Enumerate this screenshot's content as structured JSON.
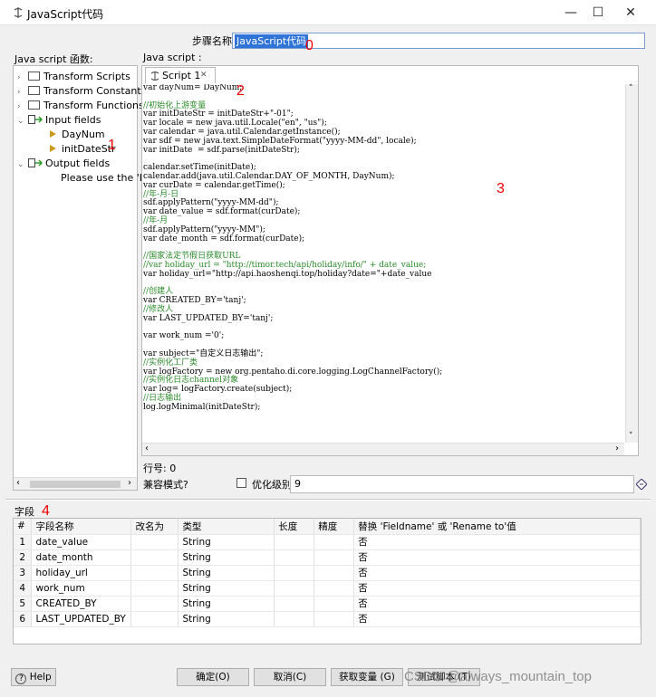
{
  "window": {
    "title": "JavaScript代码",
    "min": "—",
    "max": "☐",
    "close": "✕"
  },
  "step": {
    "label": "步骤名称",
    "value": "JavaScript代码"
  },
  "annotations": {
    "a0": "0",
    "a1": "1",
    "a2": "2",
    "a3": "3",
    "a4": "4"
  },
  "functions_panel": {
    "label": "Java script 函数:",
    "items": [
      "Transform Scripts",
      "Transform Constants",
      "Transform Functions",
      "Input fields",
      "DayNum",
      "initDateStr",
      "Output fields",
      "Please use the 'Re"
    ]
  },
  "script_panel": {
    "label": "Java script :",
    "tab": "Script 1",
    "tab_close": "✕"
  },
  "code_lines": [
    "var dayNum= DayNum;",
    "",
    "//初始化上游变量",
    "var initDateStr = initDateStr+\"-01\";",
    "var locale = new java.util.Locale(\"en\", \"us\");",
    "var calendar = java.util.Calendar.getInstance();",
    "var sdf = new java.text.SimpleDateFormat(\"yyyy-MM-dd\", locale);",
    "var initDate  = sdf.parse(initDateStr);",
    "",
    "calendar.setTime(initDate);",
    "calendar.add(java.util.Calendar.DAY_OF_MONTH, DayNum);",
    "var curDate = calendar.getTime();",
    "//年-月-日",
    "sdf.applyPattern(\"yyyy-MM-dd\");",
    "var date_value = sdf.format(curDate);",
    "//年-月",
    "sdf.applyPattern(\"yyyy-MM\");",
    "var date_month = sdf.format(curDate);",
    "",
    "//国家法定节假日获取URL",
    "//var holiday_url = \"http://timor.tech/api/holiday/info/\" + date_value;",
    "var holiday_url=\"http://api.haoshenqi.top/holiday?date=\"+date_value",
    "",
    "//创建人",
    "var CREATED_BY='tanj';",
    "//修改人",
    "var LAST_UPDATED_BY='tanj';",
    "",
    "var work_num ='0';",
    "",
    "var subject=\"自定义日志输出\";",
    "//实例化工厂类",
    "var logFactory = new org.pentaho.di.core.logging.LogChannelFactory();",
    "//实例化日志channel对象",
    "var log= logFactory.create(subject);",
    "//日志输出",
    "log.logMinimal(initDateStr);"
  ],
  "line_no": "行号: 0",
  "compat": {
    "label": "兼容模式?",
    "opt_label": "优化级别",
    "opt_value": "9"
  },
  "fields_section": {
    "label": "字段",
    "headers": [
      "#",
      "字段名称",
      "改名为",
      "类型",
      "长度",
      "精度",
      "替换 'Fieldname' 或 'Rename to'值"
    ],
    "rows": [
      [
        "1",
        "date_value",
        "",
        "String",
        "",
        "",
        "否"
      ],
      [
        "2",
        "date_month",
        "",
        "String",
        "",
        "",
        "否"
      ],
      [
        "3",
        "holiday_url",
        "",
        "String",
        "",
        "",
        "否"
      ],
      [
        "4",
        "work_num",
        "",
        "String",
        "",
        "",
        "否"
      ],
      [
        "5",
        "CREATED_BY",
        "",
        "String",
        "",
        "",
        "否"
      ],
      [
        "6",
        "LAST_UPDATED_BY",
        "",
        "String",
        "",
        "",
        "否"
      ]
    ]
  },
  "buttons": {
    "help": "Help",
    "ok": "确定(O)",
    "cancel": "取消(C)",
    "get_vars": "获取变量 (G)",
    "test": "测试脚本 (T)"
  },
  "watermark": "CSDN @always_mountain_top",
  "colors": {
    "accent": "#3174d8",
    "annotation": "#ee0000",
    "code_comment": "#2a8a2a",
    "code_keyword": "#7f0055"
  }
}
